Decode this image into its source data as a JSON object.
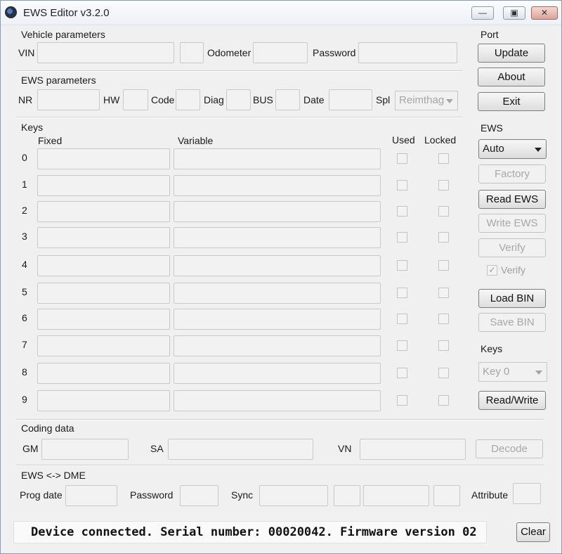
{
  "window": {
    "title": "EWS Editor v3.2.0",
    "min": "—",
    "max": "▣",
    "close": "✕"
  },
  "vehicle": {
    "section_label": "Vehicle parameters",
    "vin_label": "VIN",
    "odometer_label": "Odometer",
    "password_label": "Password"
  },
  "ews_params": {
    "section_label": "EWS parameters",
    "nr_label": "NR",
    "hw_label": "HW",
    "code_label": "Code",
    "diag_label": "Diag",
    "bus_label": "BUS",
    "date_label": "Date",
    "spl_label": "Spl",
    "spl_value": "Reimthag"
  },
  "keys": {
    "section_label": "Keys",
    "col_fixed": "Fixed",
    "col_variable": "Variable",
    "col_used": "Used",
    "col_locked": "Locked",
    "rows": [
      "0",
      "1",
      "2",
      "3",
      "4",
      "5",
      "6",
      "7",
      "8",
      "9"
    ]
  },
  "right_panel": {
    "port_label": "Port",
    "update": "Update",
    "about": "About",
    "exit": "Exit",
    "ews_label": "EWS",
    "ews_mode": "Auto",
    "factory": "Factory",
    "read_ews": "Read EWS",
    "write_ews": "Write EWS",
    "verify": "Verify",
    "verify_check_label": "Verify",
    "verify_checked": true,
    "load_bin": "Load BIN",
    "save_bin": "Save BIN",
    "keys_label": "Keys",
    "key_select": "Key 0",
    "read_write": "Read/Write"
  },
  "coding": {
    "section_label": "Coding data",
    "gm_label": "GM",
    "sa_label": "SA",
    "vn_label": "VN",
    "decode": "Decode"
  },
  "ews_dme": {
    "section_label": "EWS <-> DME",
    "prog_date_label": "Prog date",
    "password_label": "Password",
    "sync_label": "Sync",
    "attribute_label": "Attribute"
  },
  "status": {
    "text": "Device connected. Serial number: 00020042. Firmware version 02",
    "clear": "Clear"
  }
}
